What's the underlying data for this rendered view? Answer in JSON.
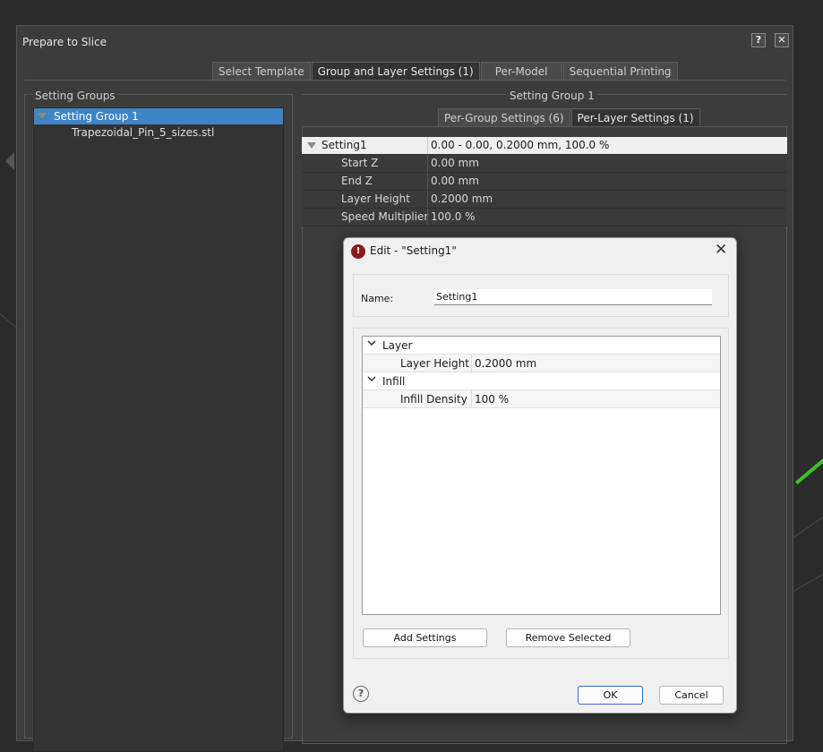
{
  "main_dialog": {
    "title": "Prepare to Slice",
    "help_label": "?",
    "close_label": "✕"
  },
  "top_tabs": [
    {
      "label": "Select Template"
    },
    {
      "label": "Group and Layer Settings (1)"
    },
    {
      "label": "Per-Model"
    },
    {
      "label": "Sequential Printing"
    }
  ],
  "setting_groups": {
    "header": "Setting Groups",
    "group_name": "Setting Group 1",
    "file_name": "Trapezoidal_Pin_5_sizes.stl"
  },
  "right_panel": {
    "title": "Setting Group 1",
    "sub_tabs": [
      {
        "label": "Per-Group Settings (6)"
      },
      {
        "label": "Per-Layer Settings (1)"
      }
    ],
    "header_row": {
      "name": "Setting1",
      "value": "0.00 - 0.00, 0.2000 mm, 100.0 %"
    },
    "rows": [
      {
        "name": "Start Z",
        "value": "0.00 mm"
      },
      {
        "name": "End Z",
        "value": "0.00 mm"
      },
      {
        "name": "Layer Height",
        "value": "0.2000 mm"
      },
      {
        "name": "Speed Multiplier",
        "value": "100.0 %"
      }
    ]
  },
  "edit_dialog": {
    "icon_glyph": "!",
    "title": "Edit - \"Setting1\"",
    "close_label": "✕",
    "name_label": "Name:",
    "name_value": "Setting1",
    "tree": {
      "layer_label": "Layer",
      "layer_height_name": "Layer Height",
      "layer_height_value": "0.2000 mm",
      "infill_label": "Infill",
      "infill_density_name": "Infill Density",
      "infill_density_value": "100 %"
    },
    "add_settings_label": "Add Settings",
    "remove_selected_label": "Remove Selected",
    "help_label": "?",
    "ok_label": "OK",
    "cancel_label": "Cancel"
  }
}
